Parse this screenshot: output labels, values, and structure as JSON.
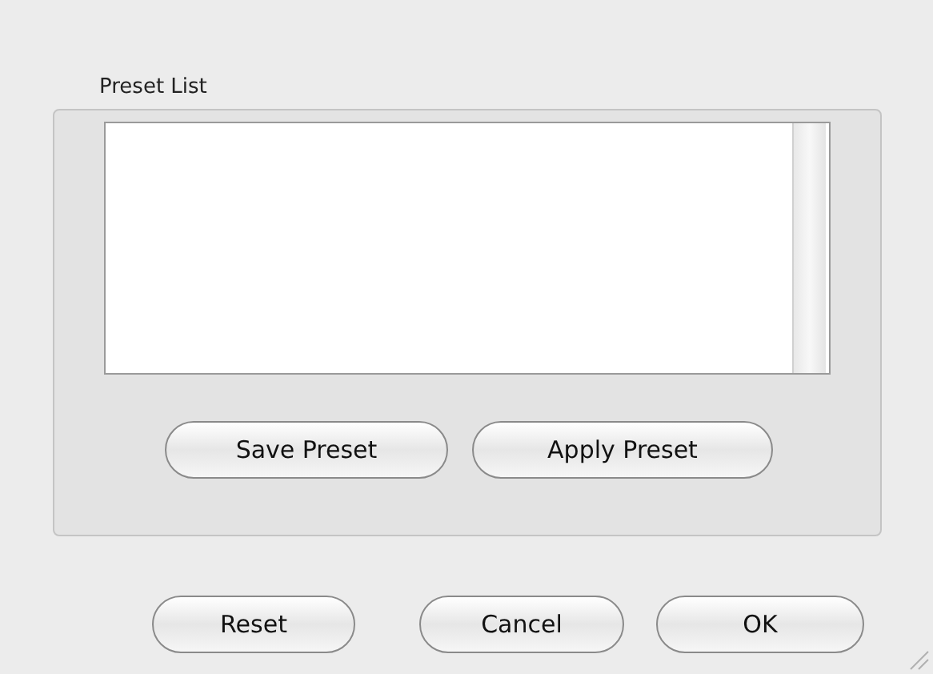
{
  "group": {
    "title": "Preset List"
  },
  "preset_buttons": [
    "Save Preset",
    "Apply Preset"
  ],
  "buttons": [
    "Reset",
    "Cancel",
    "OK"
  ]
}
